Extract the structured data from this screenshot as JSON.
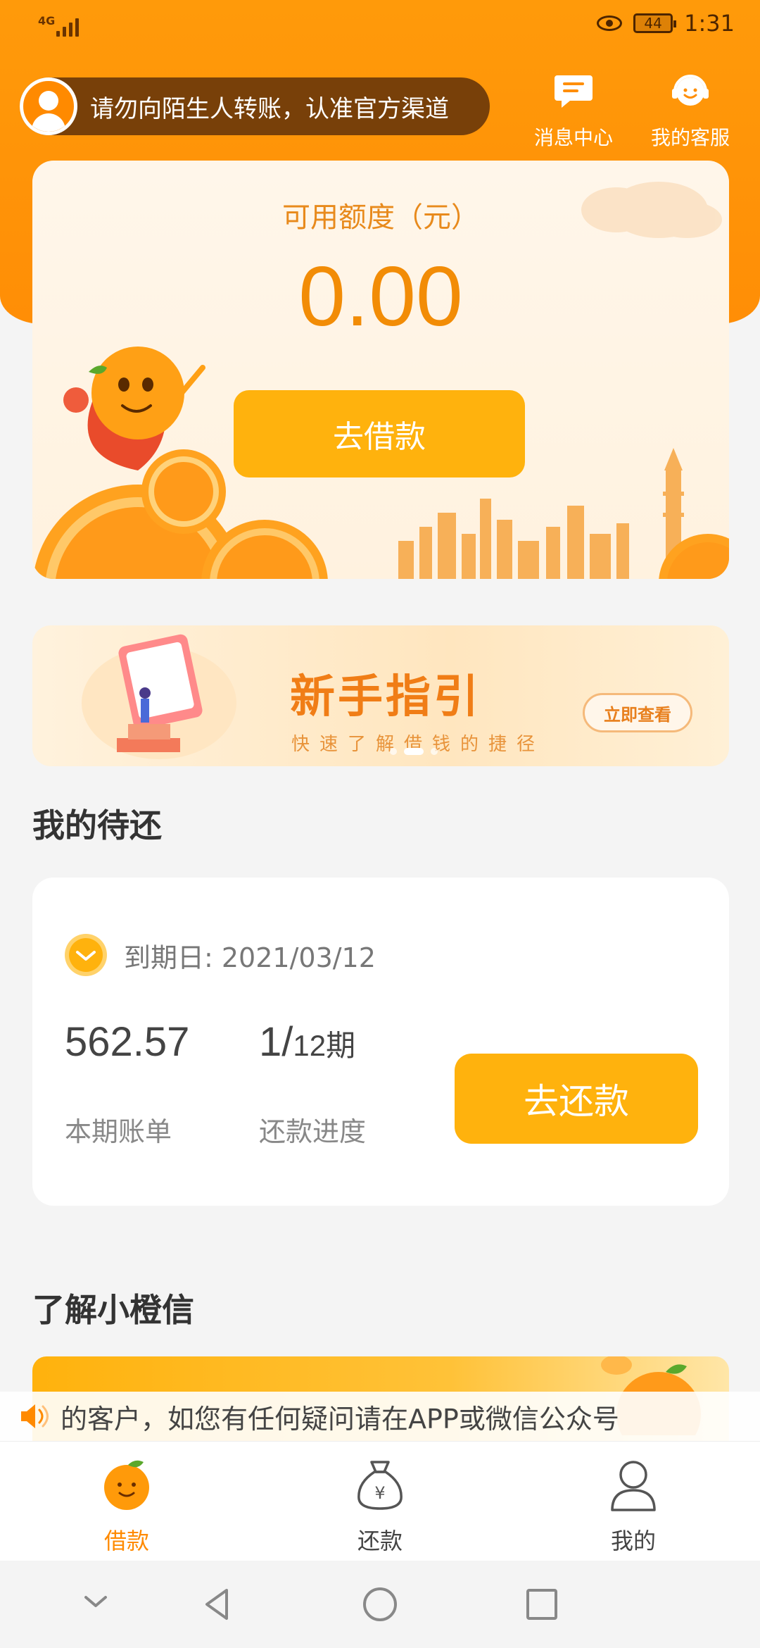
{
  "status_bar": {
    "network": "4G",
    "battery": "44",
    "time": "1:31"
  },
  "header": {
    "warning": "请勿向陌生人转账，认准官方渠道",
    "message_center": "消息中心",
    "customer_service": "我的客服"
  },
  "credit": {
    "label": "可用额度（元）",
    "amount": "0.00",
    "borrow_button": "去借款"
  },
  "banner": {
    "title": "新手指引",
    "subtitle": "快速了解借钱的捷径",
    "button": "立即查看"
  },
  "repay": {
    "section_title": "我的待还",
    "due_label": "到期日: 2021/03/12",
    "amount": "562.57",
    "amount_label": "本期账单",
    "progress_current": "1/",
    "progress_total": "12期",
    "progress_label": "还款进度",
    "repay_button": "去还款"
  },
  "about": {
    "section_title": "了解小橙信"
  },
  "marquee": {
    "text": "的客户，如您有任何疑问请在APP或微信公众号"
  },
  "tabs": [
    {
      "label": "借款",
      "icon": "orange-icon",
      "active": true
    },
    {
      "label": "还款",
      "icon": "money-bag-icon",
      "active": false
    },
    {
      "label": "我的",
      "icon": "person-icon",
      "active": false
    }
  ],
  "colors": {
    "primary": "#ff8e06",
    "button": "#ffb20d",
    "accent_text": "#f28c06"
  }
}
